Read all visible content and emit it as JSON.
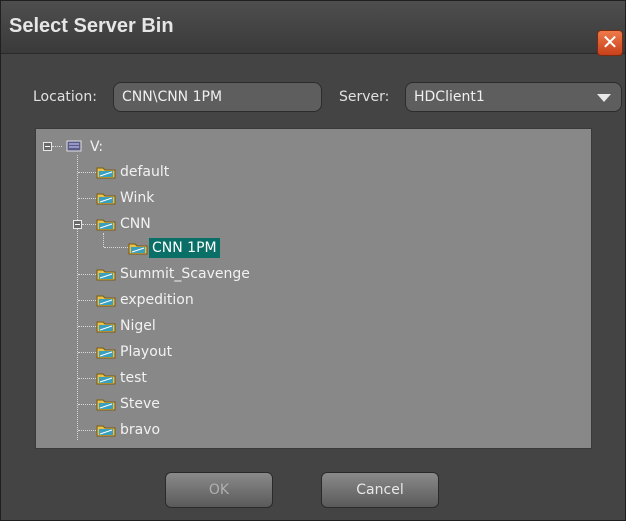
{
  "window": {
    "title": "Select Server Bin",
    "close_glyph": "✕"
  },
  "location": {
    "label": "Location:",
    "value": "CNN\\CNN 1PM"
  },
  "server": {
    "label": "Server:",
    "value": "HDClient1"
  },
  "tree": {
    "root": "V:",
    "items": [
      {
        "label": "default"
      },
      {
        "label": "Wink"
      },
      {
        "label": "CNN",
        "expanded": true,
        "children": [
          {
            "label": "CNN 1PM",
            "selected": true
          }
        ]
      },
      {
        "label": "Summit_Scavenge"
      },
      {
        "label": "expedition"
      },
      {
        "label": "Nigel"
      },
      {
        "label": "Playout"
      },
      {
        "label": "test"
      },
      {
        "label": "Steve"
      },
      {
        "label": "bravo"
      }
    ]
  },
  "buttons": {
    "ok": "OK",
    "cancel": "Cancel"
  },
  "colors": {
    "selection": "#0a6f66",
    "close": "#d9532a"
  },
  "icons": {
    "drive": "drive-icon",
    "folder": "folder-icon",
    "expander": "minus-box-icon",
    "dropdown": "chevron-down-icon"
  }
}
